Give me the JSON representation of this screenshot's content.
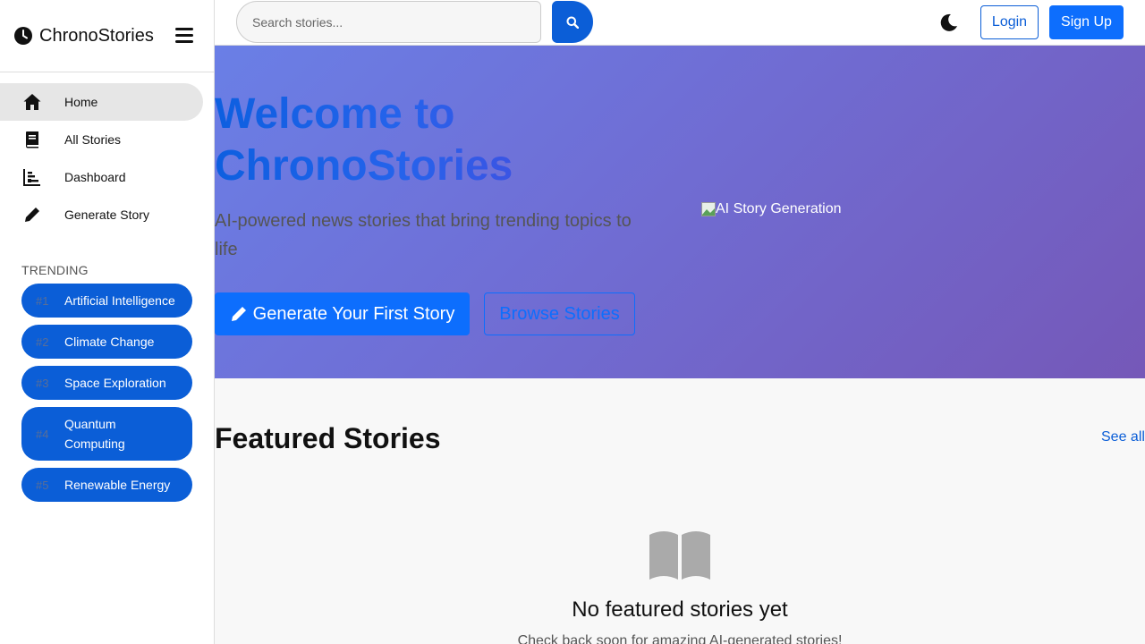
{
  "brand": {
    "name": "ChronoStories"
  },
  "header": {
    "search_placeholder": "Search stories...",
    "login_label": "Login",
    "signup_label": "Sign Up"
  },
  "sidebar": {
    "items": [
      {
        "label": "Home",
        "icon": "home-icon",
        "active": true
      },
      {
        "label": "All Stories",
        "icon": "book-icon"
      },
      {
        "label": "Dashboard",
        "icon": "bar-chart-icon"
      },
      {
        "label": "Generate Story",
        "icon": "pencil-icon"
      }
    ],
    "trending_title": "TRENDING",
    "trending": [
      {
        "rank": "#1",
        "label": "Artificial Intelligence"
      },
      {
        "rank": "#2",
        "label": "Climate Change"
      },
      {
        "rank": "#3",
        "label": "Space Exploration"
      },
      {
        "rank": "#4",
        "label": "Quantum Computing"
      },
      {
        "rank": "#5",
        "label": "Renewable Energy"
      }
    ]
  },
  "hero": {
    "title_line1": "Welcome to",
    "title_line2": "ChronoStories",
    "subtitle": "AI-powered news stories that bring trending topics to life",
    "cta_label": "Generate Your First Story",
    "browse_label": "Browse Stories",
    "image_alt": "AI Story Generation"
  },
  "featured": {
    "title": "Featured Stories",
    "see_all": "See all",
    "empty_title": "No featured stories yet",
    "empty_subtitle": "Check back soon for amazing AI-generated stories!"
  },
  "colors": {
    "primary": "#0d6efd",
    "trend_pill": "#0b5ed7",
    "hero_gradient_start": "#6a7fe6",
    "hero_gradient_end": "#7558b8"
  }
}
